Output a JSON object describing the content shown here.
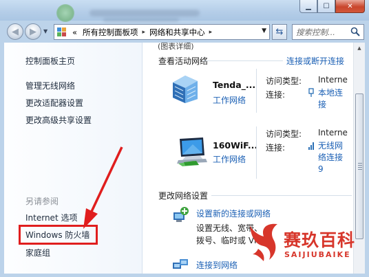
{
  "window": {
    "minimize_glyph": "▁",
    "maximize_glyph": "☐",
    "close_glyph": "✕"
  },
  "address_bar": {
    "overflow": "«",
    "crumbs": [
      "所有控制面板项",
      "网络和共享中心"
    ],
    "separator": "▸",
    "search_placeholder": "搜索控制..."
  },
  "sidebar": {
    "items": [
      "控制面板主页",
      "管理无线网络",
      "更改适配器设置",
      "更改高级共享设置"
    ],
    "see_also_title": "另请参阅",
    "see_also": [
      "Internet 选项",
      "Windows 防火墙",
      "家庭组"
    ]
  },
  "main": {
    "top_cut_text": "(图表详细)",
    "active_networks_title": "查看活动网络",
    "connect_disconnect": "连接或断开连接",
    "networks": [
      {
        "name": "Tenda_...",
        "type": "工作网络",
        "access_label": "访问类型:",
        "access_value": "Interne",
        "connection_label": "连接:",
        "connection_value": "本地连接",
        "icon": "building-network-icon"
      },
      {
        "name": "160WiF...",
        "type": "工作网络",
        "access_label": "访问类型:",
        "access_value": "Interne",
        "connection_label": "连接:",
        "connection_value": "无线网络连接 9",
        "icon": "computer-network-icon"
      }
    ],
    "change_settings_title": "更改网络设置",
    "tasks": [
      {
        "link": "设置新的连接或网络",
        "desc": "设置无线、宽带、拨号、临时或 VPN 连接；或设置路由器或访问点。"
      },
      {
        "link": "连接到网络",
        "desc": ""
      }
    ]
  },
  "watermark": {
    "title": "赛玖百科",
    "subtitle": "SAIJIUBAIKE"
  },
  "colors": {
    "link": "#1a5fb4",
    "highlight_box": "#e01e1e",
    "arrow": "#e01e1e",
    "watermark": "#d7362b"
  }
}
